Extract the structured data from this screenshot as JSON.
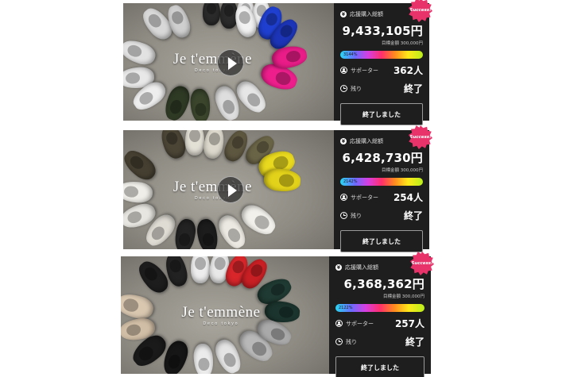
{
  "projects": [
    {
      "logo": {
        "main": "Je t'emmène",
        "sub": "Deco tokyo"
      },
      "badge": "Success!",
      "total_label": "応援購入総額",
      "amount": "9,433,105円",
      "goal": "目標金額 300,000円",
      "percent": "3144%",
      "supporters_label": "サポーター",
      "supporters": "362人",
      "remaining_label": "残り",
      "remaining": "終了",
      "button": "終了しました"
    },
    {
      "logo": {
        "main": "Je t'emmène",
        "sub": "Deco tokyo"
      },
      "badge": "Success!",
      "total_label": "応援購入総額",
      "amount": "6,428,730円",
      "goal": "目標金額 300,000円",
      "percent": "2142%",
      "supporters_label": "サポーター",
      "supporters": "254人",
      "remaining_label": "残り",
      "remaining": "終了",
      "button": "終了しました"
    },
    {
      "logo": {
        "main": "Je t'emmène",
        "sub": "Deco tokyo"
      },
      "badge": "Success!",
      "total_label": "応援購入総額",
      "amount": "6,368,362円",
      "goal": "目標金額 300,000円",
      "percent": "2122%",
      "supporters_label": "サポーター",
      "supporters": "257人",
      "remaining_label": "残り",
      "remaining": "終了",
      "button": "終了しました"
    }
  ],
  "icons": {
    "amount": "yen-icon",
    "supporters": "person-icon",
    "remaining": "clock-icon",
    "play": "play-icon"
  },
  "colors": {
    "panel": "#1e1e1e",
    "badge": "#e8336a",
    "text": "#ffffff"
  }
}
